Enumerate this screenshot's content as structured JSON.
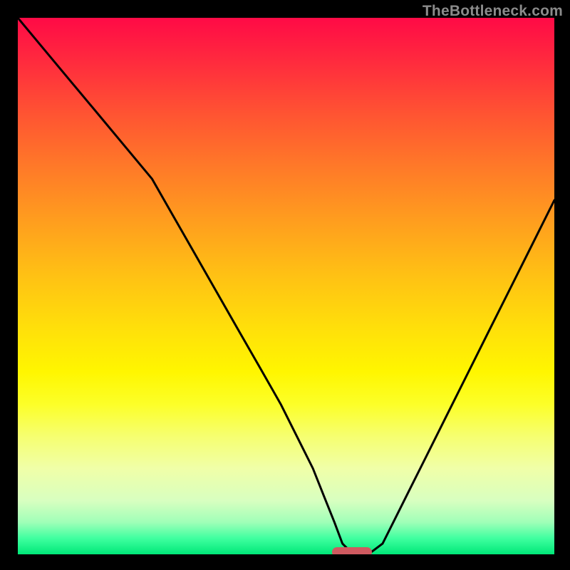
{
  "watermark": "TheBottleneck.com",
  "chart_data": {
    "type": "line",
    "title": "",
    "xlabel": "",
    "ylabel": "",
    "xlim": [
      0,
      100
    ],
    "ylim": [
      0,
      100
    ],
    "x": [
      0,
      5,
      10,
      15,
      20,
      25,
      29,
      33,
      37,
      41,
      45,
      49,
      52,
      55,
      57,
      59,
      60.5,
      62,
      64,
      66,
      68,
      70,
      73,
      76,
      80,
      84,
      88,
      92,
      96,
      100
    ],
    "values": [
      100,
      94,
      88,
      82,
      76,
      70,
      63,
      56,
      49,
      42,
      35,
      28,
      22,
      16,
      11,
      6,
      2,
      0.5,
      0.3,
      0.5,
      2,
      6,
      12,
      18,
      26,
      34,
      42,
      50,
      58,
      66
    ],
    "marker": {
      "x_start": 58.5,
      "x_end": 66,
      "y": 0.4
    }
  },
  "colors": {
    "gradient_top": "#ff0a46",
    "gradient_bottom": "#00e878",
    "curve": "#000000",
    "marker": "#cf5a60",
    "frame": "#000000",
    "watermark": "#8b8b8b"
  }
}
